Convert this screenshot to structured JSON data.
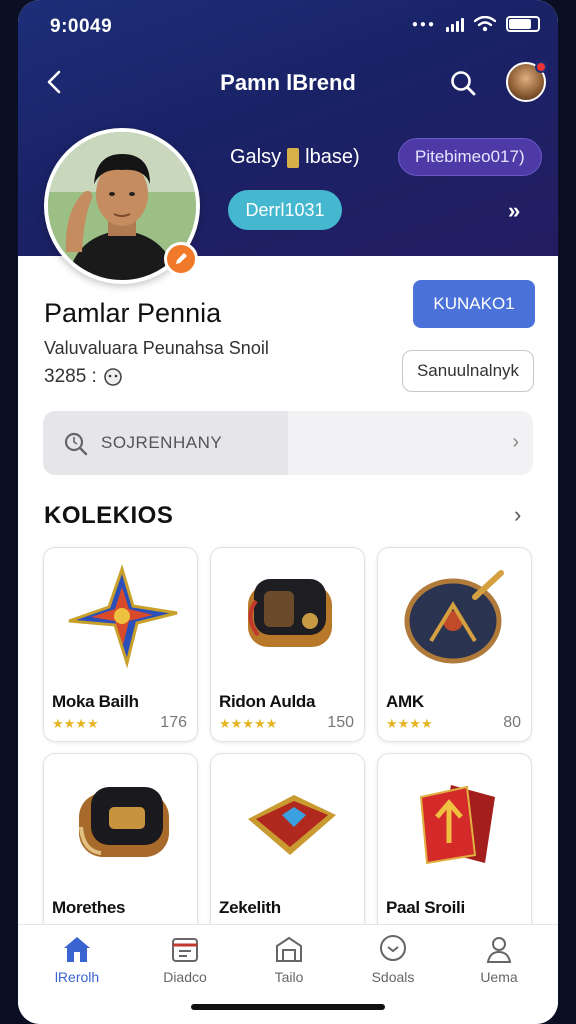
{
  "status": {
    "time": "9:0049"
  },
  "nav": {
    "title": "Pamn lBrend"
  },
  "profile": {
    "brand_text": "Galsy",
    "brand_suffix": "lbase)",
    "tag_purple": "Pitebimeo017)",
    "tag_teal": "Derrl1031",
    "name": "Pamlar Pennia",
    "subtitle": "Valuvaluara Peunahsa Snoil",
    "stat": "3285 :",
    "primary_button": "KUNAKO1",
    "secondary_button": "Sanuulnalnyk"
  },
  "search": {
    "placeholder": "SOJRENHANY"
  },
  "collection": {
    "title": "KOLEKIOS",
    "items": [
      {
        "title": "Moka Bailh",
        "stars": "★★★★",
        "count": "176"
      },
      {
        "title": "Ridon Aulda",
        "stars": "★★★★★",
        "count": "150"
      },
      {
        "title": "AMK",
        "stars": "★★★★",
        "count": "80"
      },
      {
        "title": "Morethes",
        "stars": "",
        "count": ""
      },
      {
        "title": "Zekelith",
        "stars": "",
        "count": ""
      },
      {
        "title": "Paal Sroili",
        "stars": "",
        "count": ""
      }
    ]
  },
  "tabs": [
    {
      "label": "lRerolh",
      "icon": "home-icon"
    },
    {
      "label": "Diadco",
      "icon": "calendar-icon"
    },
    {
      "label": "Tailo",
      "icon": "shop-icon"
    },
    {
      "label": "Sdoals",
      "icon": "chat-icon"
    },
    {
      "label": "Uema",
      "icon": "user-icon"
    }
  ],
  "colors": {
    "header": "#1d2e78",
    "accent": "#4a72d8",
    "teal": "#45b8d0",
    "purple": "#4d3aa6",
    "star": "#e6b422"
  }
}
